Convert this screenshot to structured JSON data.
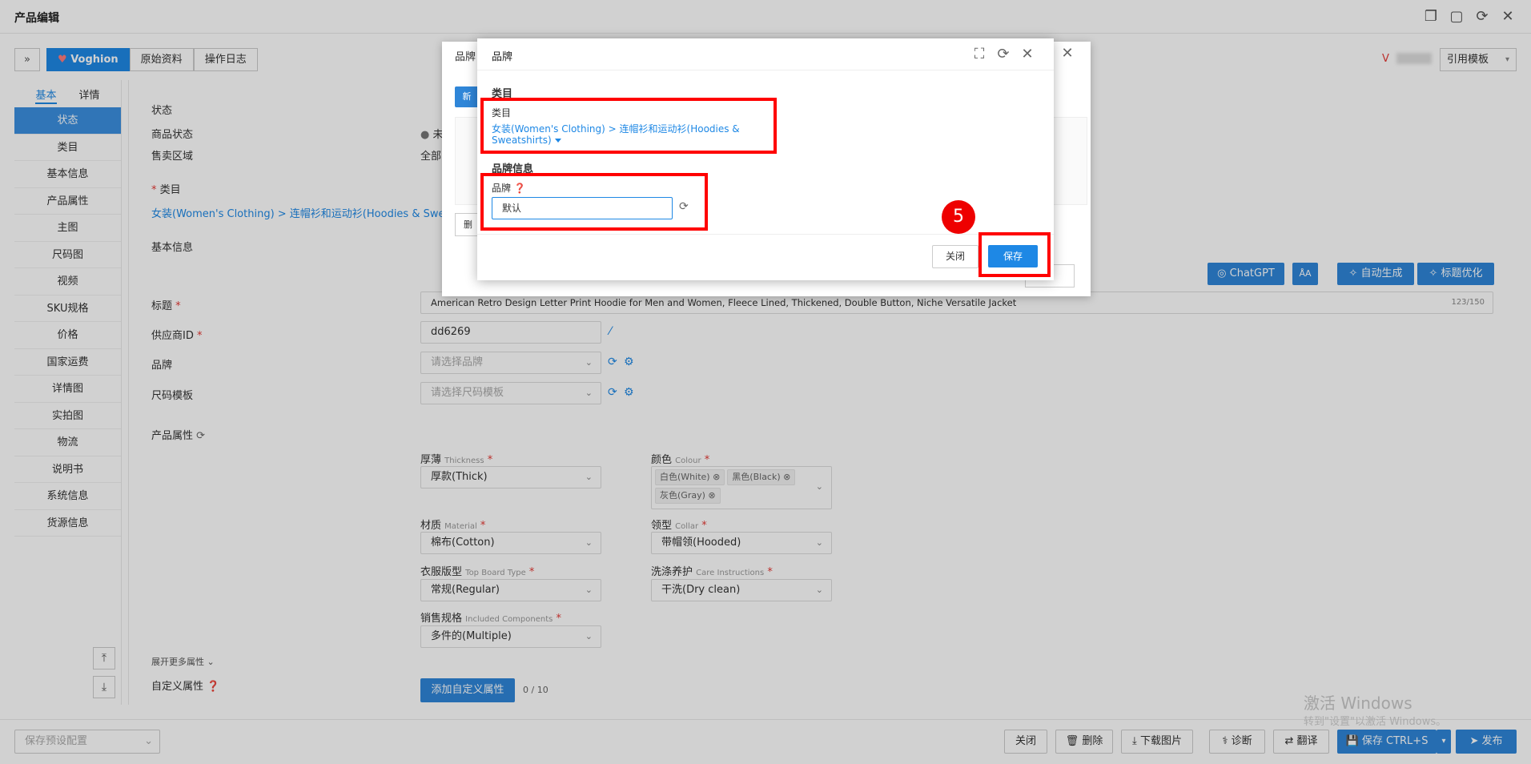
{
  "window": {
    "title": "产品编辑"
  },
  "toolbar": {
    "tabs": [
      "Voghion",
      "原始资料",
      "操作日志"
    ],
    "user_label": "Voghion",
    "template_btn": "引用模板"
  },
  "sidebar": {
    "tabs": [
      "基本",
      "详情"
    ],
    "items": [
      "状态",
      "类目",
      "基本信息",
      "产品属性",
      "主图",
      "尺码图",
      "视频",
      "SKU规格",
      "价格",
      "国家运费",
      "详情图",
      "实拍图",
      "物流",
      "说明书",
      "系统信息",
      "货源信息"
    ]
  },
  "main": {
    "status_section": "状态",
    "product_status_label": "商品状态",
    "product_status_value": "未",
    "sale_region_label": "售卖区域",
    "sale_region_value": "全部",
    "category_label": "类目",
    "category_value": "女装(Women's Clothing) > 连帽衫和运动衫(Hoodies & Sweatshirts)",
    "basic_section": "基本信息",
    "title_label": "标题",
    "title_value": "American Retro Design Letter Print Hoodie for Men and Women, Fleece Lined, Thickened, Double Button, Niche Versatile Jacket",
    "title_count": "123/150",
    "supplier_label": "供应商ID",
    "supplier_value": "dd6269",
    "brand_label": "品牌",
    "brand_placeholder": "请选择品牌",
    "size_tpl_label": "尺码模板",
    "size_tpl_placeholder": "请选择尺码模板",
    "attr_section": "产品属性",
    "ai_buttons": {
      "chatgpt": "ChatGPT",
      "translate": "ÅA",
      "auto": "自动生成",
      "optimize": "标题优化"
    },
    "attributes": {
      "thickness": {
        "label": "厚薄",
        "sub": "Thickness",
        "value": "厚款(Thick)"
      },
      "colour": {
        "label": "颜色",
        "sub": "Colour",
        "tags": [
          "白色(White)",
          "黑色(Black)",
          "灰色(Gray)"
        ]
      },
      "material": {
        "label": "材质",
        "sub": "Material",
        "value": "棉布(Cotton)"
      },
      "collar": {
        "label": "领型",
        "sub": "Collar",
        "value": "带帽领(Hooded)"
      },
      "topboard": {
        "label": "衣服版型",
        "sub": "Top Board Type",
        "value": "常规(Regular)"
      },
      "care": {
        "label": "洗涤养护",
        "sub": "Care Instructions",
        "value": "干洗(Dry clean)"
      },
      "components": {
        "label": "销售规格",
        "sub": "Included Components",
        "value": "多件的(Multiple)"
      }
    },
    "expand_more": "展开更多属性",
    "custom_attr_label": "自定义属性",
    "add_custom_attr_btn": "添加自定义属性",
    "custom_attr_count": "0 / 10"
  },
  "footer": {
    "preset_placeholder": "保存预设配置",
    "close": "关闭",
    "delete": "删除",
    "download": "下载图片",
    "diagnose": "诊断",
    "translate": "翻译",
    "save": "保存 CTRL+S",
    "publish": "发布"
  },
  "back_dialog": {
    "title": "品牌",
    "new_btn": "新",
    "delete_btn": "删",
    "close_btn": "关闭"
  },
  "dialog": {
    "title": "品牌",
    "category_section": "类目",
    "category_label": "类目",
    "category_value": "女装(Women's Clothing) > 连帽衫和运动衫(Hoodies & Sweatshirts)",
    "brand_section": "品牌信息",
    "brand_label": "品牌",
    "brand_value": "默认",
    "close_btn": "关闭",
    "save_btn": "保存"
  },
  "annotation": {
    "step": "5"
  },
  "watermark": {
    "line1": "激活 Windows",
    "line2": "转到\"设置\"以激活 Windows。"
  },
  "colors": {
    "accent": "#1e88e5",
    "highlight": "#ff0000"
  }
}
